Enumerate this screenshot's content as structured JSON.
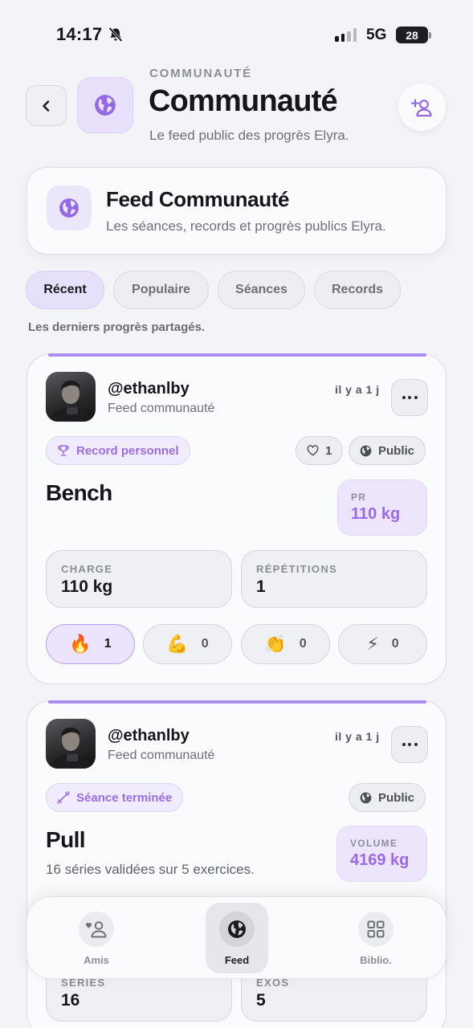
{
  "status_bar": {
    "time": "14:17",
    "network": "5G",
    "battery": "28"
  },
  "header": {
    "eyebrow": "COMMUNAUTÉ",
    "title": "Communauté",
    "subtitle": "Le feed public des progrès Elyra."
  },
  "feed_card": {
    "title": "Feed Communauté",
    "description": "Les séances, records et progrès publics Elyra."
  },
  "tabs": [
    {
      "label": "Récent",
      "active": true
    },
    {
      "label": "Populaire",
      "active": false
    },
    {
      "label": "Séances",
      "active": false
    },
    {
      "label": "Records",
      "active": false
    }
  ],
  "tab_hint": "Les derniers progrès partagés.",
  "posts": [
    {
      "username": "@ethanlby",
      "feed": "Feed communauté",
      "time": "il y a 1 j",
      "badge": "Record personnel",
      "badge_icon": "trophy-icon",
      "likes": "1",
      "visibility": "Public",
      "exercise": "Bench",
      "metric_label": "PR",
      "metric_value": "110 kg",
      "stats": [
        {
          "label": "CHARGE",
          "value": "110 kg"
        },
        {
          "label": "RÉPÉTITIONS",
          "value": "1"
        }
      ],
      "reactions": [
        {
          "emoji": "🔥",
          "count": "1",
          "active": true
        },
        {
          "emoji": "💪",
          "count": "0",
          "active": false
        },
        {
          "emoji": "👏",
          "count": "0",
          "active": false
        },
        {
          "emoji": "⚡",
          "count": "0",
          "active": false
        }
      ]
    },
    {
      "username": "@ethanlby",
      "feed": "Feed communauté",
      "time": "il y a 1 j",
      "badge": "Séance terminée",
      "badge_icon": "dumbbell-icon",
      "visibility": "Public",
      "exercise": "Pull",
      "description": "16 séries validées sur 5 exercices.",
      "metric_label": "VOLUME",
      "metric_value": "4169 kg",
      "stats": [
        {
          "label": "SÉRIES",
          "value": "16"
        },
        {
          "label": "EXOS",
          "value": "5"
        }
      ]
    }
  ],
  "bottom_nav": [
    {
      "label": "Amis",
      "icon": "friends-icon",
      "active": false
    },
    {
      "label": "Feed",
      "icon": "globe-icon",
      "active": true
    },
    {
      "label": "Biblio.",
      "icon": "grid-icon",
      "active": false
    }
  ],
  "colors": {
    "accent": "#9a6de6",
    "accent_bg": "#ece5fb",
    "background": "#f3f4f7"
  }
}
